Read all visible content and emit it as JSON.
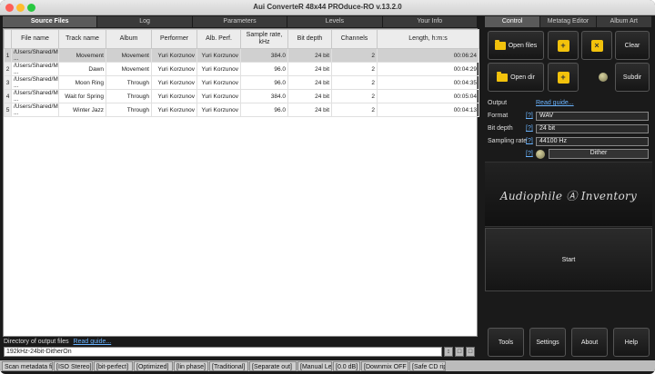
{
  "window": {
    "title": "Aui ConverteR 48x44 PROduce-RO v.13.2.0"
  },
  "left_tabs": [
    "Source Files",
    "Log",
    "Parameters",
    "Levels",
    "Your Info"
  ],
  "right_tabs": [
    "Control",
    "Metatag Editor",
    "Album Art"
  ],
  "table": {
    "columns": [
      "File name",
      "Track name",
      "Album",
      "Performer",
      "Alb. Perf.",
      "Sample rate, kHz",
      "Bit depth",
      "Channels",
      "Length, h:m:s"
    ],
    "rows": [
      {
        "n": "1",
        "file": "/Users/Shared/Music/Yuri ...",
        "track": "Movement",
        "album": "Movement",
        "performer": "Yuri Korzunov",
        "alb_perf": "Yuri Korzunov",
        "rate": "384.0",
        "depth": "24 bit",
        "channels": "2",
        "length": "00:06:24"
      },
      {
        "n": "2",
        "file": "/Users/Shared/Music/Yuri ...",
        "track": "Dawn",
        "album": "Movement",
        "performer": "Yuri Korzunov",
        "alb_perf": "Yuri Korzunov",
        "rate": "96.0",
        "depth": "24 bit",
        "channels": "2",
        "length": "00:04:29"
      },
      {
        "n": "3",
        "file": "/Users/Shared/Music/Yuri ...",
        "track": "Moon Ring",
        "album": "Through",
        "performer": "Yuri Korzunov",
        "alb_perf": "Yuri Korzunov",
        "rate": "96.0",
        "depth": "24 bit",
        "channels": "2",
        "length": "00:04:35"
      },
      {
        "n": "4",
        "file": "/Users/Shared/Music/Yuri ...",
        "track": "Wait for Spring",
        "album": "Through",
        "performer": "Yuri Korzunov",
        "alb_perf": "Yuri Korzunov",
        "rate": "384.0",
        "depth": "24 bit",
        "channels": "2",
        "length": "00:05:04"
      },
      {
        "n": "5",
        "file": "/Users/Shared/Music/Yuri ...",
        "track": "Winter Jazz",
        "album": "Through",
        "performer": "Yuri Korzunov",
        "alb_perf": "Yuri Korzunov",
        "rate": "96.0",
        "depth": "24 bit",
        "channels": "2",
        "length": "00:04:13"
      }
    ]
  },
  "output_dir": {
    "label": "Directory of output files",
    "guide": "Read guide...",
    "value": "192kHz-24bit-DitherOn"
  },
  "statusbar": [
    "Scan metadata fi",
    "[ISO Stereo]",
    "[bit-perfect]",
    "[Optimized]",
    "[lin phase]",
    "[Traditional]",
    "[Separate out]",
    "[Manual Le",
    "[0.0 dB]",
    "[Downmix OFF",
    "[Safe CD rip"
  ],
  "control": {
    "open_files": "Open files",
    "open_dir": "Open dir",
    "clear": "Clear",
    "subdir": "Subdir",
    "add_symbol": "+",
    "remove_symbol": "×",
    "output_label": "Output",
    "output_guide": "Read guide...",
    "format_label": "Format",
    "format_value": "WAV",
    "bitdepth_label": "Bit depth",
    "bitdepth_value": "24 bit",
    "rate_label": "Sampling rate",
    "rate_value": "44100 Hz",
    "help": "[?]",
    "dither": "Dither",
    "logo_text": "Audiophile Ⓐ Inventory",
    "start": "Start",
    "tools": "Tools",
    "settings": "Settings",
    "about": "About",
    "help_button": "Help"
  },
  "colors": {
    "accent_yellow": "#f2c20c",
    "link": "#6ab4ff",
    "panel_bg": "#1a1a1a"
  }
}
